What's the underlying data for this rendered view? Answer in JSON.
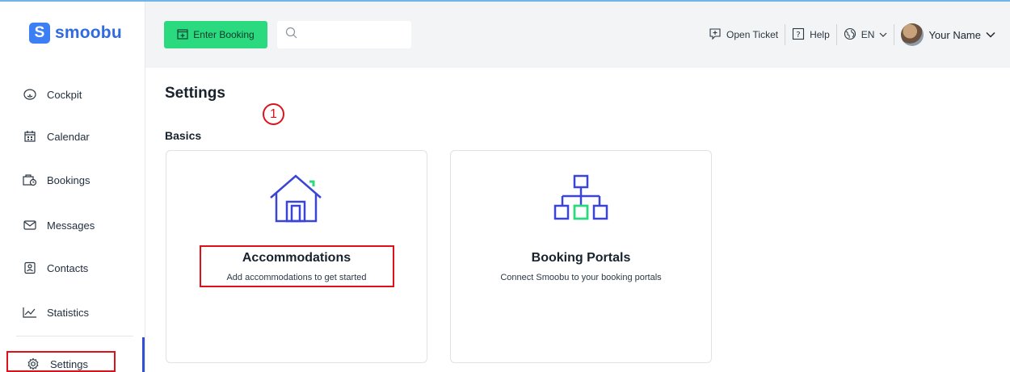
{
  "app": {
    "logo_text": "smoobu",
    "logo_letter": "S"
  },
  "sidebar": {
    "items": [
      {
        "label": "Cockpit",
        "icon": "gauge-icon"
      },
      {
        "label": "Calendar",
        "icon": "calendar-icon"
      },
      {
        "label": "Bookings",
        "icon": "briefcase-icon"
      },
      {
        "label": "Messages",
        "icon": "envelope-icon"
      },
      {
        "label": "Contacts",
        "icon": "contact-card-icon"
      },
      {
        "label": "Statistics",
        "icon": "chart-icon"
      },
      {
        "label": "Settings",
        "icon": "gear-icon"
      }
    ]
  },
  "header": {
    "enter_booking_label": "Enter Booking",
    "search_placeholder": "",
    "open_ticket_label": "Open Ticket",
    "help_label": "Help",
    "language_label": "EN",
    "user_name": "Your Name"
  },
  "main": {
    "page_title": "Settings",
    "annotation_number": "1",
    "section_title": "Basics",
    "cards": [
      {
        "title": "Accommodations",
        "subtitle": "Add accommodations to get started",
        "icon": "house-icon"
      },
      {
        "title": "Booking Portals",
        "subtitle": "Connect Smoobu to your booking portals",
        "icon": "network-icon"
      }
    ]
  },
  "colors": {
    "accent_green": "#2bd97e",
    "brand_blue": "#3c7ef3",
    "icon_blue": "#3a45d6",
    "annotation_red": "#e0101a"
  }
}
